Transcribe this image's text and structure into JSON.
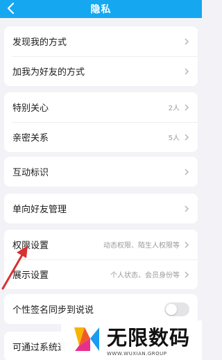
{
  "header": {
    "title": "隐私",
    "back_icon": "back-arrow-icon",
    "color": "#15a8f0"
  },
  "groups": [
    {
      "items": [
        {
          "label": "发现我的方式",
          "value": ""
        },
        {
          "label": "加我为好友的方式",
          "value": ""
        }
      ]
    },
    {
      "items": [
        {
          "label": "特别关心",
          "value": "2人"
        },
        {
          "label": "亲密关系",
          "value": "5人"
        }
      ]
    },
    {
      "items": [
        {
          "label": "互动标识",
          "value": ""
        }
      ]
    },
    {
      "items": [
        {
          "label": "单向好友管理",
          "value": ""
        }
      ]
    },
    {
      "items": [
        {
          "label": "权限设置",
          "value": "动态权限、陌生人权限等"
        },
        {
          "label": "展示设置",
          "value": "个人状态、会员身份等"
        }
      ]
    },
    {
      "items": [
        {
          "label": "个性签名同步到说说",
          "toggle": false
        }
      ]
    },
    {
      "items": [
        {
          "label": "可通过系统通"
        }
      ]
    }
  ],
  "annotation": {
    "arrow_color": "#d93030"
  },
  "watermark": {
    "brand": "无限数码",
    "url": "WWW.WUXIAN.GROUP"
  }
}
